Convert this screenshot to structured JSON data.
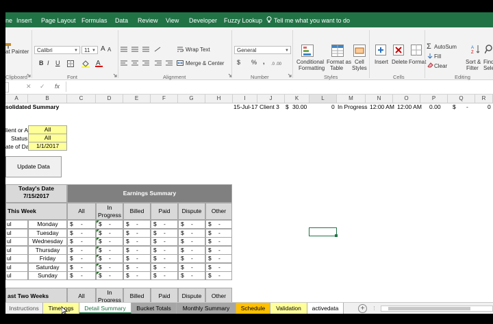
{
  "ribbon_tabs": [
    "ne",
    "Insert",
    "Page Layout",
    "Formulas",
    "Data",
    "Review",
    "View",
    "Developer",
    "Fuzzy Lookup"
  ],
  "tell_me": "Tell me what you want to do",
  "clipboard": {
    "format_painter": "at Painter",
    "label": "Clipboard"
  },
  "font": {
    "name": "Calibri",
    "size": "11",
    "label": "Font",
    "bold": "B",
    "italic": "I",
    "underline": "U",
    "grow": "A",
    "shrink": "A"
  },
  "alignment": {
    "wrap_text": "Wrap Text",
    "merge_center": "Merge & Center",
    "label": "Alignment"
  },
  "number": {
    "format": "General",
    "currency": "$",
    "percent": "%",
    "comma": ",",
    "label": "Number"
  },
  "styles": {
    "conditional": "Conditional",
    "conditional2": "Formatting",
    "format_as": "Format as",
    "format_as2": "Table",
    "cell_styles": "Cell",
    "cell_styles2": "Styles",
    "label": "Styles"
  },
  "cells": {
    "insert": "Insert",
    "delete": "Delete",
    "format": "Format",
    "label": "Cells"
  },
  "editing": {
    "autosum": "AutoSum",
    "fill": "Fill",
    "clear": "Clear",
    "sort": "Sort &",
    "sort2": "Filter",
    "find": "Find",
    "find2": "Selec",
    "label": "Editing"
  },
  "formula_bar": {
    "fx": "fx",
    "cancel": "✕",
    "enter": "✓"
  },
  "columns": [
    "A",
    "B",
    "C",
    "D",
    "E",
    "F",
    "G",
    "H",
    "I",
    "J",
    "K",
    "L",
    "M",
    "N",
    "O",
    "P",
    "Q",
    "R"
  ],
  "sheet": {
    "title": "solidated Summary",
    "summary_row": {
      "date": "15-Jul-17",
      "client": "Client 3",
      "currency": "$",
      "amount": "30.00",
      "zero": "0",
      "status": "In Progress",
      "start": "12:00 AM",
      "end": "12:00 AM",
      "p": "0.00",
      "q_cur": "$",
      "q_val": "-",
      "r_val": "0"
    },
    "client_label": "lient or All",
    "client_value": "All",
    "status_label": "Status",
    "status_value": "All",
    "date_label": "ate of Data",
    "date_value": "1/1/2017",
    "update_button": "Update Data",
    "todays_date_label": "Today's Date",
    "todays_date_value": "7/15/2017",
    "earnings_summary": "Earnings Summary",
    "this_week": "This Week",
    "headers": [
      "All",
      "In Progress",
      "Billed",
      "Paid",
      "Dispute",
      "Other"
    ],
    "day_prefix": "ul",
    "days": [
      "Monday",
      "Tuesday",
      "Wednesday",
      "Thursday",
      "Friday",
      "Saturday",
      "Sunday"
    ],
    "dollar": "$",
    "dash": "-",
    "last_two_weeks": "ast Two Weeks"
  },
  "sheet_tabs": [
    "Instructions",
    "TimeLogs",
    "Detail Summary",
    "Bucket Totals",
    "Monthly Summary",
    "Schedule",
    "Validation",
    "activedata"
  ],
  "colors": {
    "excel_green": "#217346",
    "yellow": "#ffff99",
    "header_grey": "#808080",
    "light_grey": "#d9d9d9"
  }
}
